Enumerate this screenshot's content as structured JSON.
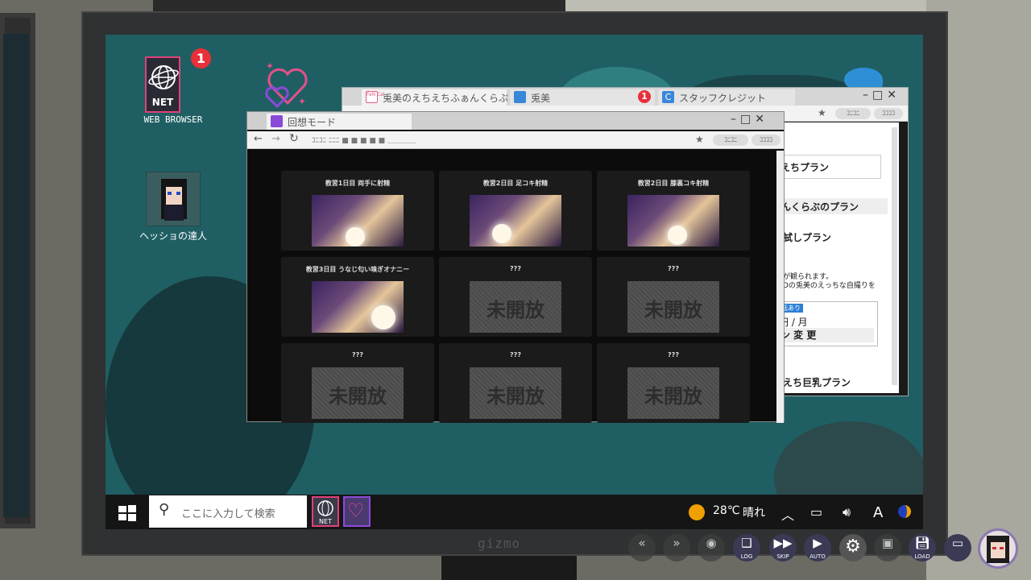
{
  "desktop": {
    "net_icon_label": "NET",
    "net_badge": "1",
    "net_label": "WEB BROWSER",
    "hess_label": "ヘッショの達人"
  },
  "monitor": {
    "brand": "gizmo"
  },
  "back_window": {
    "tabs": [
      {
        "label": "兎美のえちえちふぁんくらぶ",
        "icon": "fanclub-icon"
      },
      {
        "label": "兎美",
        "icon": "bunny-icon"
      },
      {
        "label": "スタッフクレジット",
        "icon": "credits-icon",
        "badge": "1"
      }
    ],
    "pill1": "ｺﾆｺﾆ",
    "pill2": "ｺｺｺｺ",
    "plans": {
      "plan1": "えちプラン",
      "section": "んくらぶのプラン",
      "trial": "試しプラン",
      "desc1": "が観られます。",
      "desc2": "Dの兎美のえっちな自撮りを",
      "tag": "話あり",
      "price": "円 / 月",
      "change_btn": "ン 変 更",
      "plan2": "えち巨乳プラン"
    }
  },
  "front_window": {
    "tab_label": "回想モード",
    "url_text": "ｺﾆｺﾆ ﾆﾆﾆ ■ ■ ■ ■ ■ ＿＿＿＿",
    "pill1": "ｺﾆｺﾆ",
    "pill2": "ｺｺｺｺ",
    "gallery": [
      {
        "title": "教習1日目 両手に射精",
        "locked": false
      },
      {
        "title": "教習2日目 足コキ射精",
        "locked": false
      },
      {
        "title": "教習2日目 膝裏コキ射精",
        "locked": false
      },
      {
        "title": "教習3日目 うなじ匂い嗅ぎオナニー",
        "locked": false
      },
      {
        "title": "???",
        "locked": true
      },
      {
        "title": "???",
        "locked": true
      },
      {
        "title": "???",
        "locked": true
      },
      {
        "title": "???",
        "locked": true
      },
      {
        "title": "???",
        "locked": true
      }
    ],
    "locked_text": "未開放"
  },
  "taskbar": {
    "search_placeholder": "ここに入力して検索",
    "app1_label": "NET",
    "temperature": "28℃",
    "weather": "晴れ",
    "input_indicator": "A"
  },
  "hud": {
    "log": "LOG",
    "skip": "SKIP",
    "auto": "AUTO",
    "load": "LOAD"
  },
  "colors": {
    "accent_pink": "#e0407a",
    "desktop_bg": "#1f5f63",
    "badge_red": "#e8303a",
    "hud_button": "#3a3a55"
  }
}
